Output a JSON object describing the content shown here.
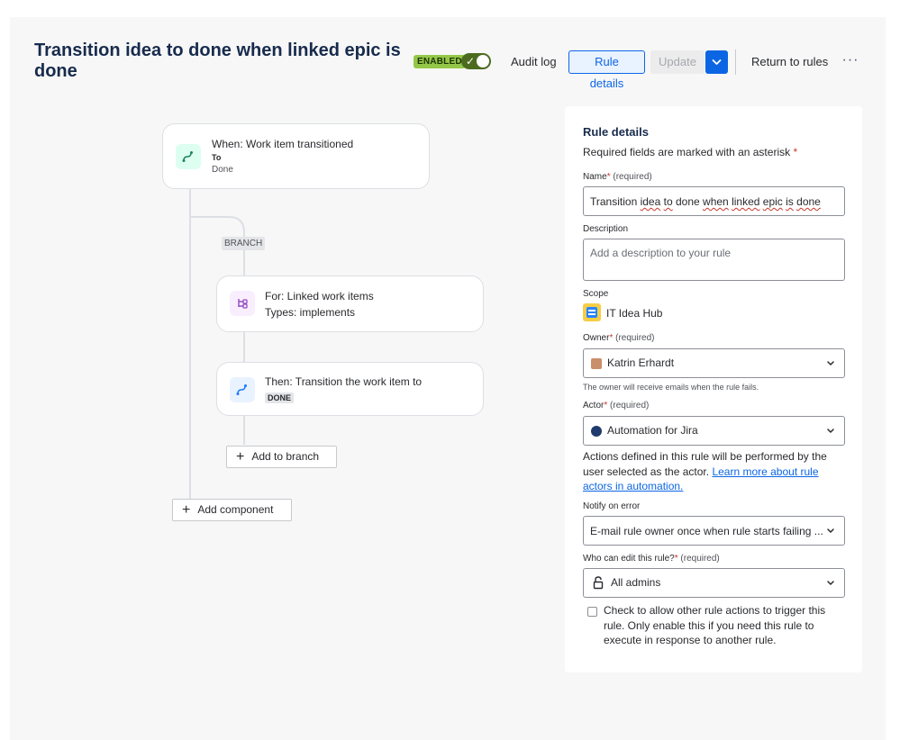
{
  "header": {
    "title": "Transition idea to done when linked epic is done",
    "status_badge": "ENABLED",
    "audit_log": "Audit log",
    "rule_details": "Rule details",
    "update": "Update",
    "return_to_rules": "Return to rules",
    "more": "···"
  },
  "flow": {
    "trigger": {
      "title": "When: Work item transitioned",
      "sub_label": "To",
      "sub_value": "Done"
    },
    "branch_label": "BRANCH",
    "branch_card": {
      "line1": "For: Linked work items",
      "line2": "Types: implements"
    },
    "action_card": {
      "line1": "Then: Transition the work item to",
      "pill": "DONE"
    },
    "add_to_branch": "Add to branch",
    "add_component": "Add component"
  },
  "panel": {
    "title": "Rule details",
    "required_note": "Required fields are marked with an asterisk",
    "asterisk": "*",
    "name": {
      "label": "Name",
      "req": "(required)",
      "value": "Transition idea to done when linked epic is done"
    },
    "description": {
      "label": "Description",
      "placeholder": "Add a description to your rule"
    },
    "scope": {
      "label": "Scope",
      "value": "IT Idea Hub"
    },
    "owner": {
      "label": "Owner",
      "req": "(required)",
      "value": "Katrin Erhardt",
      "help": "The owner will receive emails when the rule fails."
    },
    "actor": {
      "label": "Actor",
      "req": "(required)",
      "value": "Automation for Jira",
      "help_prefix": "Actions defined in this rule will be performed by the user selected as the actor.",
      "help_link": "Learn more about rule actors in automation."
    },
    "notify": {
      "label": "Notify on error",
      "value": "E-mail rule owner once when rule starts failing ..."
    },
    "who_can_edit": {
      "label": "Who can edit this rule?",
      "req": "(required)",
      "value": "All admins"
    },
    "allow_trigger": "Check to allow other rule actions to trigger this rule. Only enable this if you need this rule to execute in response to another rule."
  },
  "colors": {
    "accent": "#0c66e4",
    "enabled": "#94c748",
    "toggle": "#4c6b1f",
    "required": "#c9372c"
  }
}
